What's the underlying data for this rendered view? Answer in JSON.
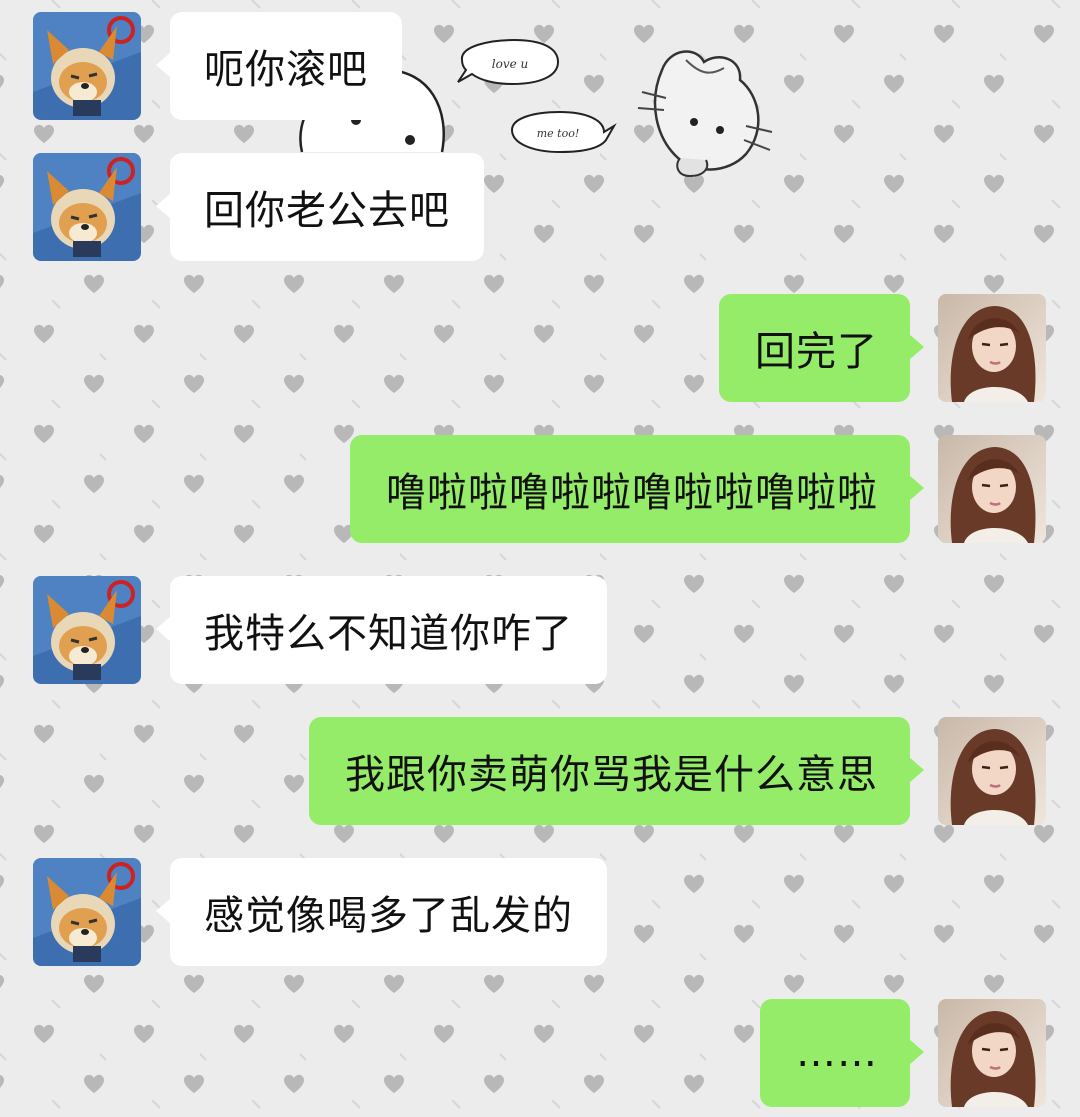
{
  "conversation": {
    "messages": [
      {
        "side": "in",
        "text": "呃你滚吧"
      },
      {
        "side": "in",
        "text": "回你老公去吧"
      },
      {
        "side": "out",
        "text": "回完了"
      },
      {
        "side": "out",
        "text": "噜啦啦噜啦啦噜啦啦噜啦啦"
      },
      {
        "side": "in",
        "text": "我特么不知道你咋了"
      },
      {
        "side": "out",
        "text": "我跟你卖萌你骂我是什么意思"
      },
      {
        "side": "in",
        "text": "感觉像喝多了乱发的"
      },
      {
        "side": "out",
        "text": "……"
      }
    ]
  },
  "sticker": {
    "bubble_left": "love u",
    "bubble_right": "me too!"
  },
  "colors": {
    "background": "#ececec",
    "heart": "#b8b8b8",
    "incoming_bubble": "#ffffff",
    "outgoing_bubble": "#95ec69"
  },
  "icons": {
    "contact_avatar": "cartoon-dog-with-hat-icon",
    "self_avatar": "long-hair-girl-photo-icon",
    "background": "heart-pattern"
  }
}
